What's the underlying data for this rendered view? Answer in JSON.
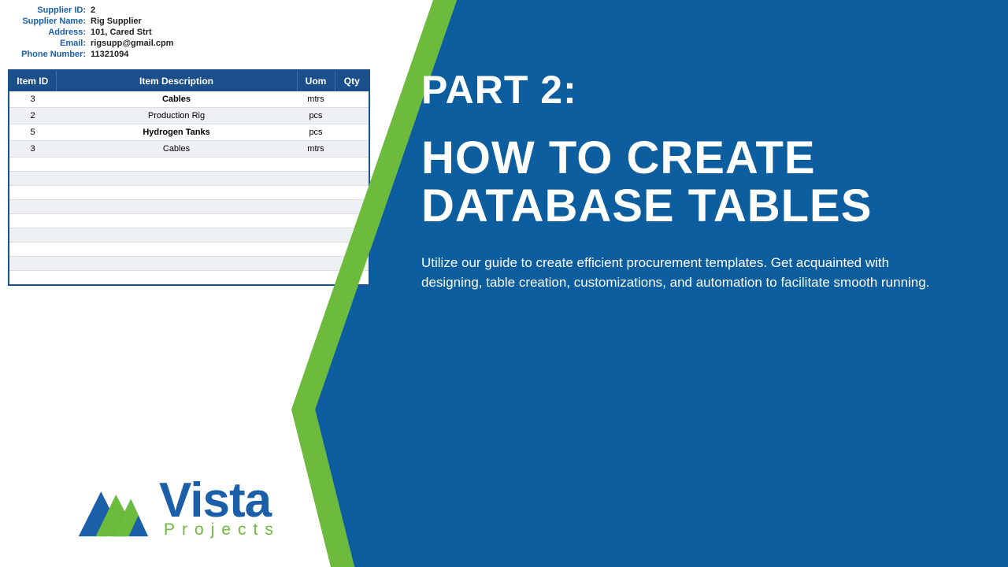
{
  "heading": {
    "part": "PART 2:",
    "title": "HOW TO CREATE DATABASE TABLES",
    "description": "Utilize our guide to create efficient procurement templates. Get acquainted with designing, table creation, customizations, and automation to facilitate smooth running."
  },
  "supplier": {
    "fields": [
      {
        "label": "Supplier ID:",
        "value": "2"
      },
      {
        "label": "Supplier Name:",
        "value": "Rig Supplier"
      },
      {
        "label": "Address:",
        "value": "101, Cared Strt"
      },
      {
        "label": "Email:",
        "value": "rigsupp@gmail.cpm"
      },
      {
        "label": "Phone Number:",
        "value": "11321094"
      }
    ]
  },
  "table": {
    "headers": [
      "Item ID",
      "Item Description",
      "Uom",
      "Qty"
    ],
    "rows": [
      {
        "id": "3",
        "desc": "Cables",
        "uom": "mtrs",
        "bold": true
      },
      {
        "id": "2",
        "desc": "Production Rig",
        "uom": "pcs",
        "bold": false
      },
      {
        "id": "5",
        "desc": "Hydrogen Tanks",
        "uom": "pcs",
        "bold": true
      },
      {
        "id": "3",
        "desc": "Cables",
        "uom": "mtrs",
        "bold": false
      }
    ]
  },
  "logo": {
    "name": "Vista",
    "sub": "Projects"
  },
  "colors": {
    "blue": "#0d5e9e",
    "green": "#6cbb3c",
    "tableHeader": "#1b4f8b"
  }
}
